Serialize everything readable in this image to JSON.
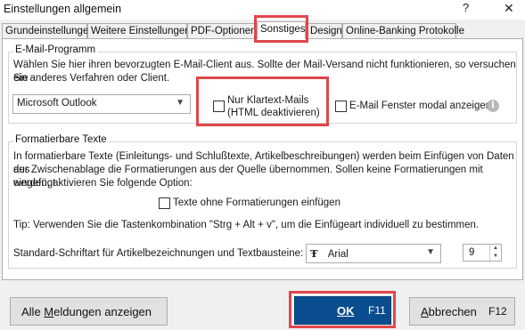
{
  "window": {
    "title": "Einstellungen allgemein",
    "help_glyph": "?",
    "close_glyph": "✕"
  },
  "tabs": [
    {
      "label": "Grundeinstellungen"
    },
    {
      "label": "Weitere Einstellungen"
    },
    {
      "label": "PDF-Optionen"
    },
    {
      "label": "Sonstiges",
      "active": true
    },
    {
      "label": "Design"
    },
    {
      "label": "Online-Banking Protokolle"
    }
  ],
  "email": {
    "legend": "E-Mail-Programm",
    "description_line1": "Wählen Sie hier ihren bevorzugten E-Mail-Client aus. Sollte der Mail-Versand nicht funktionieren, so versuchen Sie",
    "description_line2": "ein anderes Verfahren oder Client.",
    "client": "Microsoft Outlook",
    "plaintext_line1": "Nur Klartext-Mails",
    "plaintext_line2": "(HTML deaktivieren)",
    "plaintext_checked": false,
    "modal_label": "E-Mail Fenster modal anzeigen",
    "modal_checked": false
  },
  "formatted": {
    "legend": "Formatierbare Texte",
    "description_line1": "In formatierbare Texte (Einleitungs- und Schlußtexte, Artikelbeschreibungen) werden beim Einfügen von Daten aus",
    "description_line2": "der Zwischenablage die Formatierungen aus der Quelle übernommen. Sollen keine Formatierungen mit eingefügt",
    "description_line3": "werden, aktivieren Sie folgende Option:",
    "no_format_label": "Texte ohne Formatierungen einfügen",
    "no_format_checked": false,
    "tip": "Tip: Verwenden Sie die Tastenkombination \"Strg + Alt + v\", um die Einfügeart individuell zu bestimmen.",
    "font_label": "Standard-Schriftart für Artikelbezeichnungen und Textbausteine:",
    "font_icon": "Ŧ",
    "font_name": "Arial",
    "font_size": "9"
  },
  "buttons": {
    "all_messages_pre": "Alle ",
    "all_messages_mnemonic": "M",
    "all_messages_post": "eldungen anzeigen",
    "ok": "OK",
    "ok_key": "F11",
    "cancel_mnemonic": "A",
    "cancel_rest": "bbrechen",
    "cancel_key": "F12"
  },
  "colors": {
    "highlight": "#e0464b",
    "ok_bg": "#0a4d8f"
  }
}
